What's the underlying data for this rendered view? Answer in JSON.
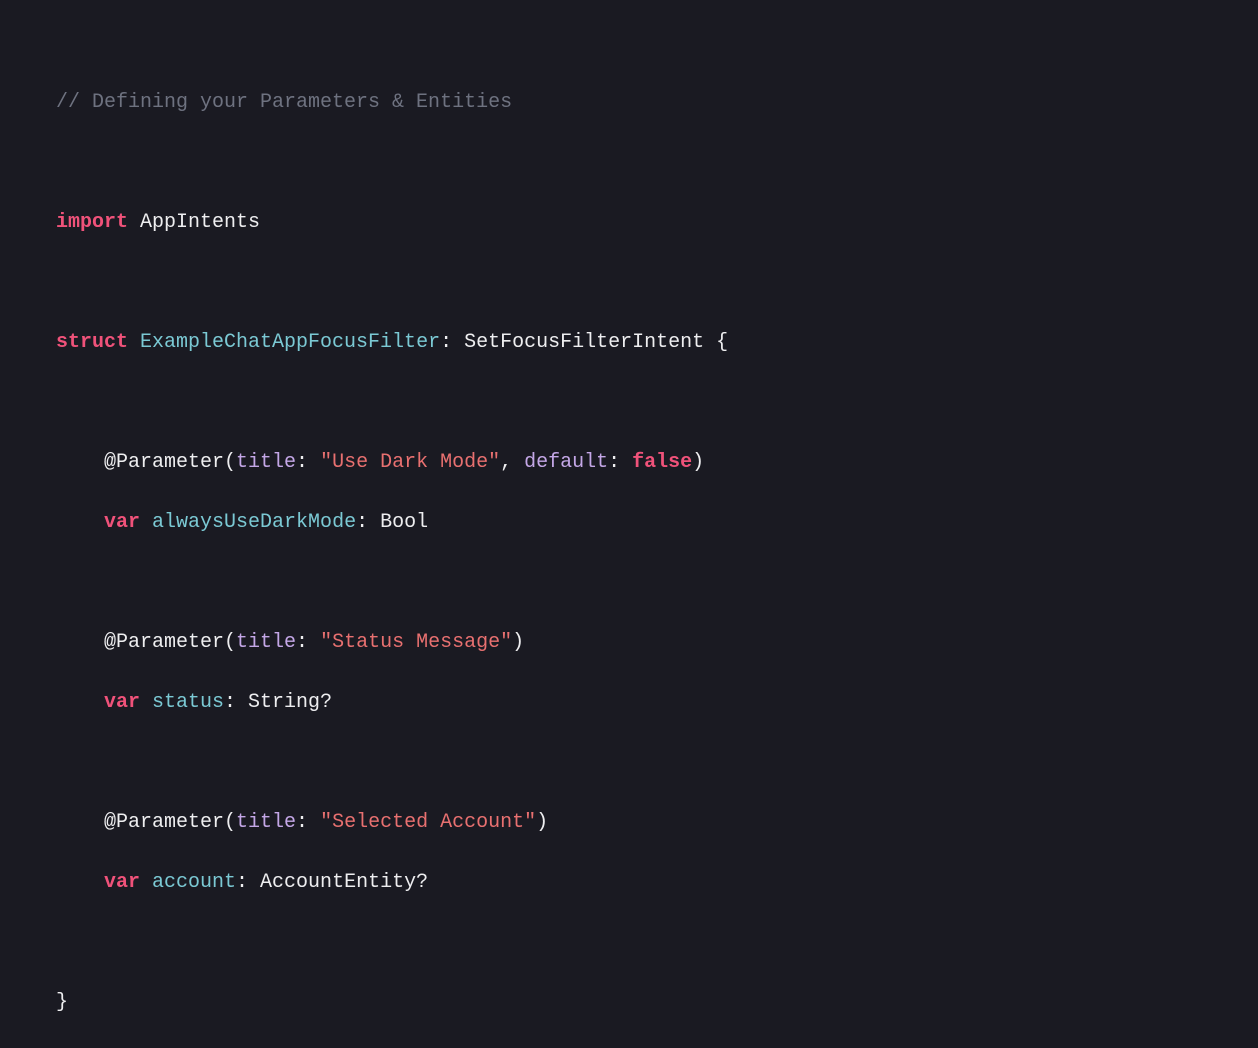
{
  "code": {
    "comment": "// Defining your Parameters & Entities",
    "import_kw": "import",
    "import_module": " AppIntents",
    "struct_kw": "struct",
    "struct_name": " ExampleChatAppFocusFilter",
    "colon_protocol": ": SetFocusFilterIntent {",
    "param1_attr": "    @Parameter(",
    "param1_title_label": "title",
    "param1_title_colon": ": ",
    "param1_title_value": "\"Use Dark Mode\"",
    "param1_comma": ", ",
    "param1_default_label": "default",
    "param1_default_colon": ": ",
    "param1_default_value": "false",
    "param1_close": ")",
    "param1_var_indent": "    ",
    "param1_var_kw": "var",
    "param1_var_name": " alwaysUseDarkMode",
    "param1_var_type": ": Bool",
    "param2_attr": "    @Parameter(",
    "param2_title_label": "title",
    "param2_title_colon": ": ",
    "param2_title_value": "\"Status Message\"",
    "param2_close": ")",
    "param2_var_indent": "    ",
    "param2_var_kw": "var",
    "param2_var_name": " status",
    "param2_var_type": ": String?",
    "param3_attr": "    @Parameter(",
    "param3_title_label": "title",
    "param3_title_colon": ": ",
    "param3_title_value": "\"Selected Account\"",
    "param3_close": ")",
    "param3_var_indent": "    ",
    "param3_var_kw": "var",
    "param3_var_name": " account",
    "param3_var_type": ": AccountEntity?",
    "close_brace": "}"
  }
}
